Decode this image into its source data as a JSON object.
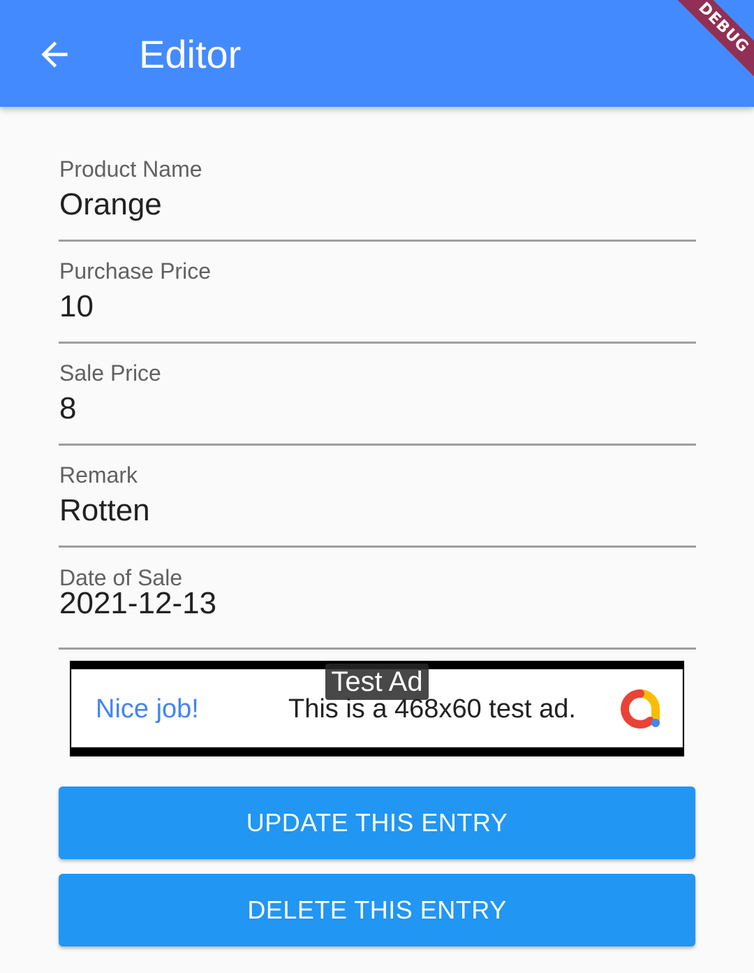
{
  "app_bar": {
    "title": "Editor",
    "back_icon": "arrow-back-icon",
    "background": "#448aff"
  },
  "debug_banner": {
    "label": "DEBUG"
  },
  "form": {
    "fields": [
      {
        "label": "Product Name",
        "value": "Orange"
      },
      {
        "label": "Purchase Price",
        "value": "10"
      },
      {
        "label": "Sale Price",
        "value": "8"
      },
      {
        "label": "Remark",
        "value": "Rotten"
      },
      {
        "label": "Date of Sale",
        "value": "2021-12-13"
      }
    ]
  },
  "ad": {
    "label": "Test Ad",
    "headline": "Nice job!",
    "body": "This is a 468x60 test ad.",
    "logo_icon": "ad-logo-icon"
  },
  "buttons": {
    "update_label": "UPDATE THIS ENTRY",
    "delete_label": "DELETE THIS ENTRY",
    "color": "#2196f3"
  }
}
